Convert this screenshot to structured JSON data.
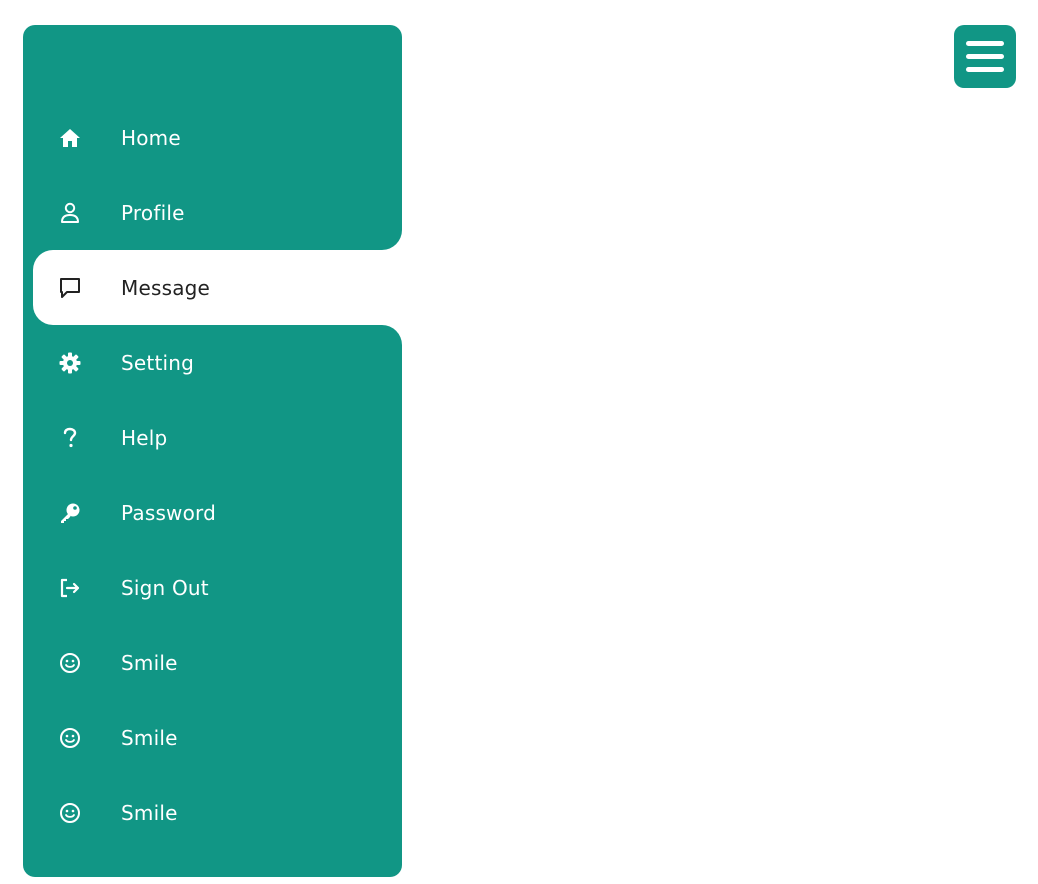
{
  "colors": {
    "sidebar_bg": "#119685",
    "active_bg": "#ffffff",
    "text_light": "#ffffff",
    "text_dark": "#222222"
  },
  "sidebar": {
    "items": [
      {
        "label": "Home",
        "icon": "home-icon",
        "active": false
      },
      {
        "label": "Profile",
        "icon": "user-icon",
        "active": false
      },
      {
        "label": "Message",
        "icon": "message-icon",
        "active": true
      },
      {
        "label": "Setting",
        "icon": "gear-icon",
        "active": false
      },
      {
        "label": "Help",
        "icon": "question-icon",
        "active": false
      },
      {
        "label": "Password",
        "icon": "key-icon",
        "active": false
      },
      {
        "label": "Sign Out",
        "icon": "sign-out-icon",
        "active": false
      },
      {
        "label": "Smile",
        "icon": "smile-icon",
        "active": false
      },
      {
        "label": "Smile",
        "icon": "smile-icon",
        "active": false
      },
      {
        "label": "Smile",
        "icon": "smile-icon",
        "active": false
      }
    ]
  },
  "header": {
    "menu_toggle_icon": "hamburger-icon"
  }
}
